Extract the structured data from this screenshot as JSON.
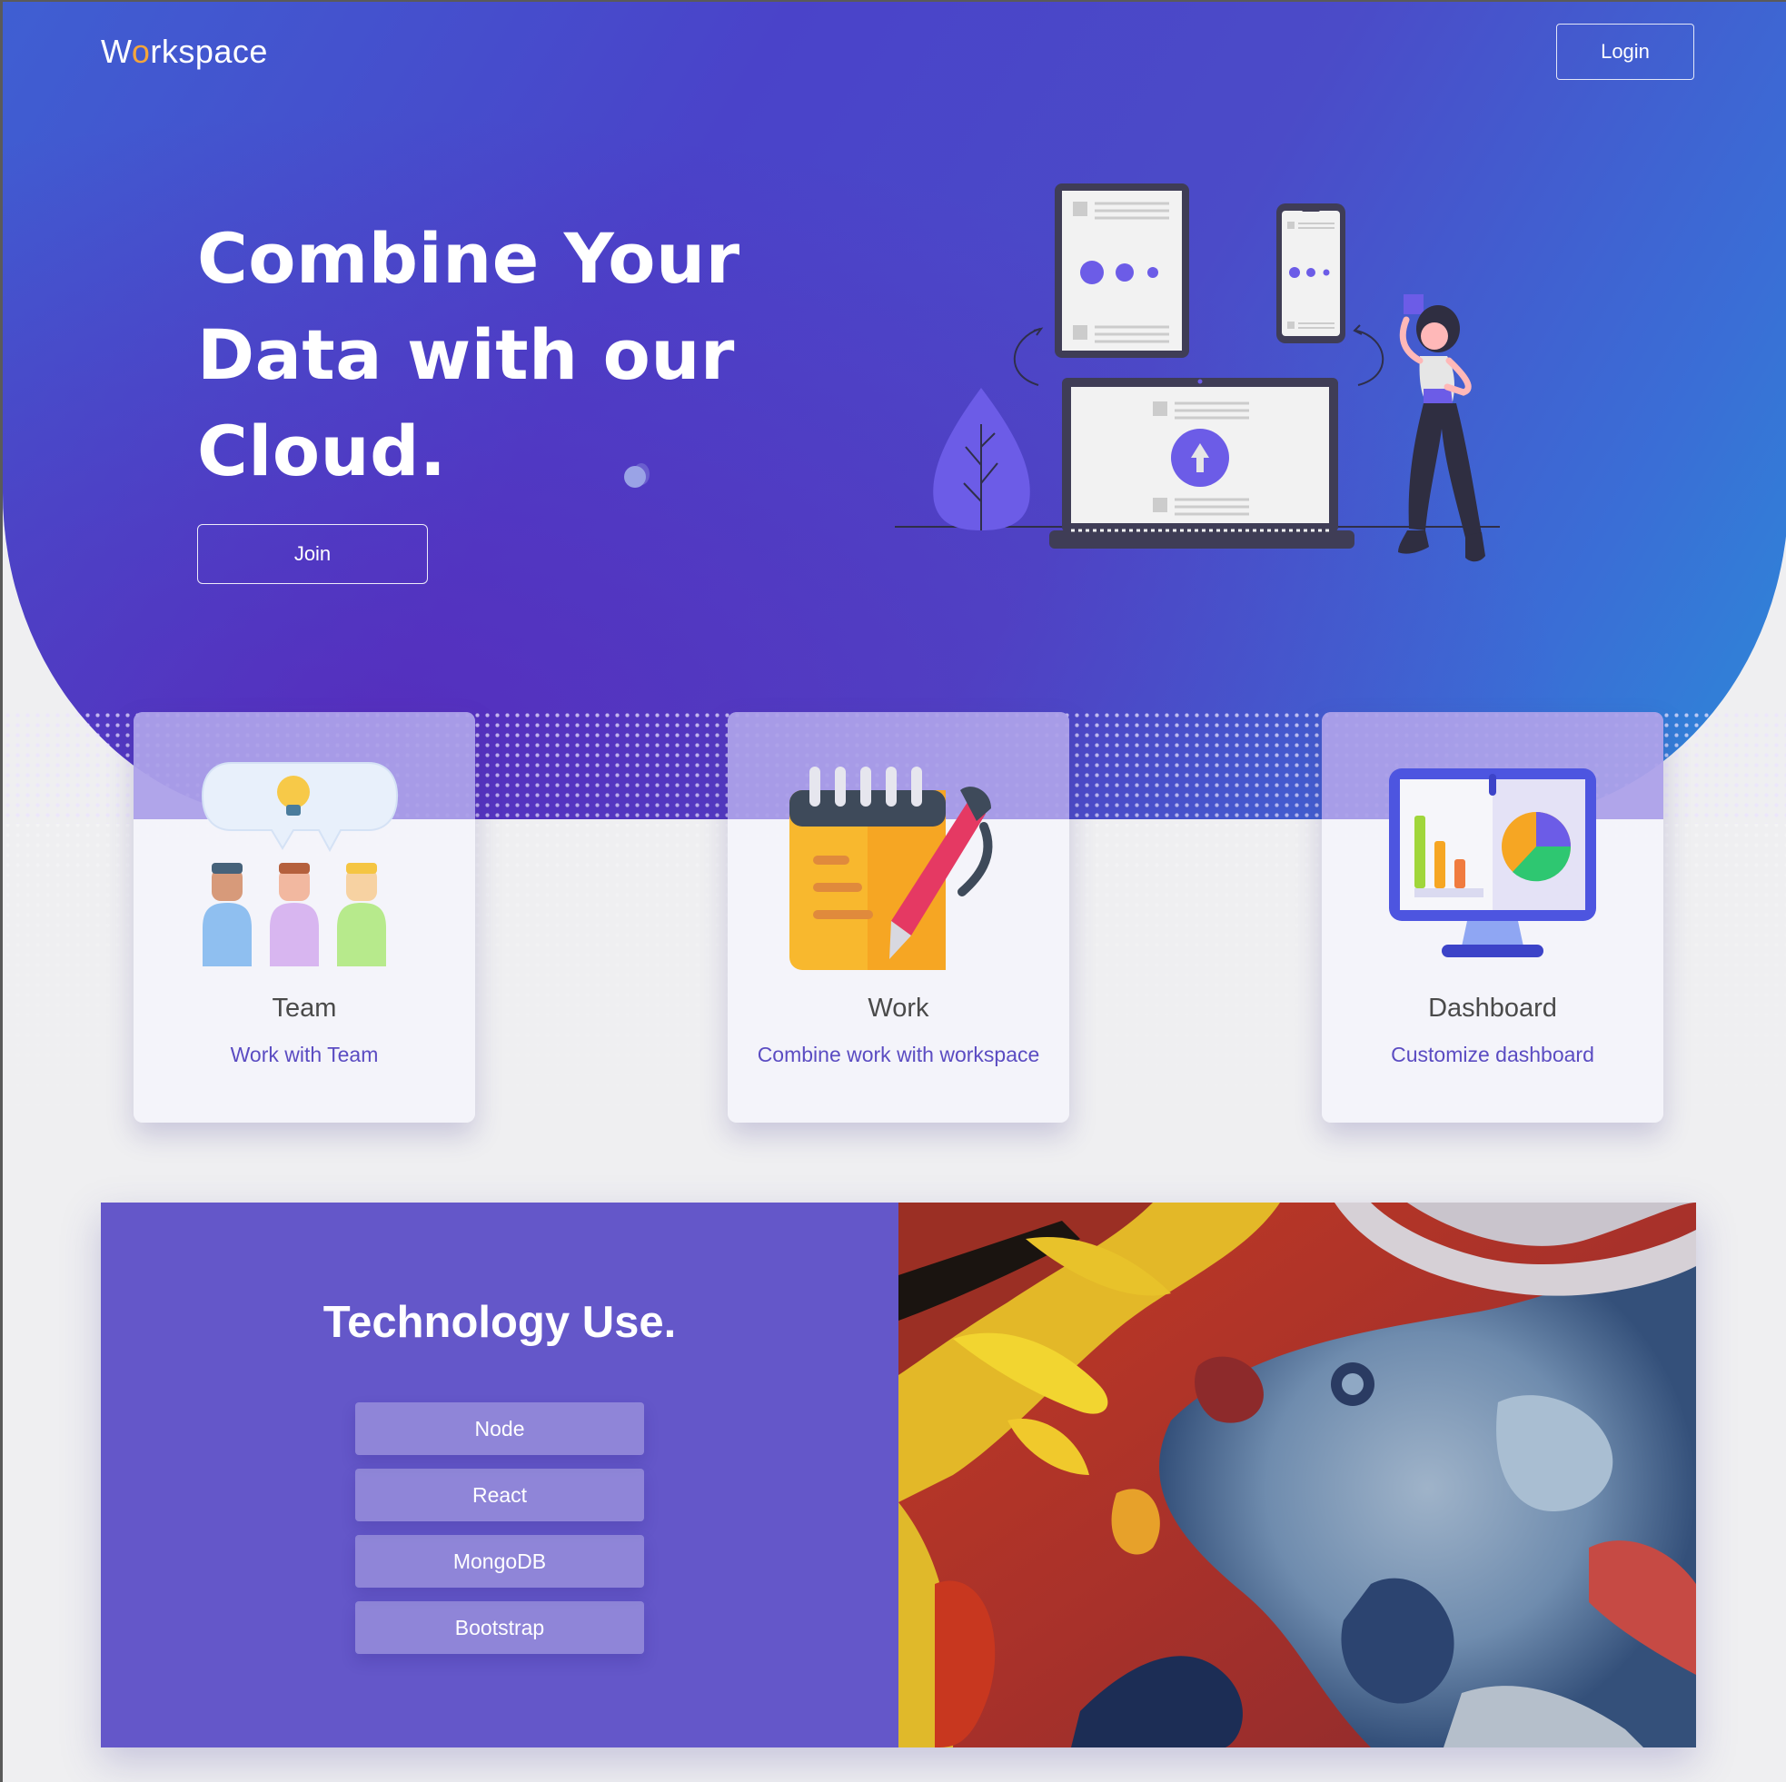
{
  "brand": {
    "prefix": "W",
    "accent": "o",
    "suffix": "rkspace",
    "accent_color": "#f4a53b"
  },
  "nav": {
    "login_label": "Login"
  },
  "hero": {
    "headline_line1": "Combine Your",
    "headline_line2": "Data with our",
    "headline_line3": "Cloud.",
    "join_label": "Join"
  },
  "features": [
    {
      "title": "Team",
      "subtitle": "Work with Team",
      "icon": "team-icon"
    },
    {
      "title": "Work",
      "subtitle": "Combine work with workspace",
      "icon": "notepad-pen-icon"
    },
    {
      "title": "Dashboard",
      "subtitle": "Customize dashboard",
      "icon": "dashboard-monitor-icon"
    }
  ],
  "tech": {
    "title": "Technology Use.",
    "items": [
      "Node",
      "React",
      "MongoDB",
      "Bootstrap"
    ]
  },
  "colors": {
    "hero_gradient_start": "#3f5fd2",
    "hero_gradient_end": "#2c8ad8",
    "tech_panel": "#6457c9",
    "link_purple": "#5b4cc2"
  }
}
